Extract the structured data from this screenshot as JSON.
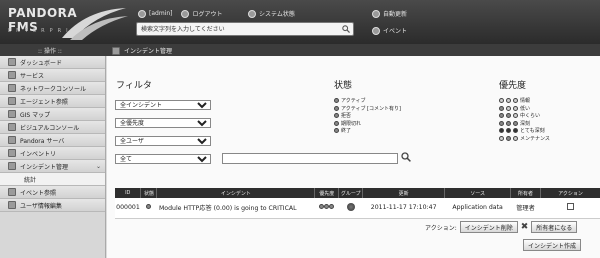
{
  "header": {
    "logo_main": "PANDORA",
    "logo_fms": "FMS",
    "logo_sub": "ENTERPRISE",
    "user": "[admin]",
    "user_action": "ログアウト",
    "system_status": "システム状態",
    "auto_refresh": "自動更新",
    "events": "イベント",
    "search_placeholder": "検索文字列を入力してください"
  },
  "subbar": {
    "operation_label": "操作",
    "page_title": "インシデント管理"
  },
  "sidebar": {
    "items": [
      {
        "label": "ダッシュボード"
      },
      {
        "label": "サービス"
      },
      {
        "label": "ネットワークコンソール"
      },
      {
        "label": "エージェント参照"
      },
      {
        "label": "GIS マップ"
      },
      {
        "label": "ビジュアルコンソール"
      },
      {
        "label": "Pandora サーバ"
      },
      {
        "label": "インベントリ"
      },
      {
        "label": "インシデント管理"
      },
      {
        "label": "統計"
      },
      {
        "label": "イベント参照"
      },
      {
        "label": "ユーザ情報編集"
      }
    ]
  },
  "filter": {
    "title": "フィルタ",
    "incidents_value": "全インシデント",
    "priority_value": "全優先度",
    "users_value": "全ユーザ",
    "groups_value": "全て"
  },
  "status_legend": {
    "title": "状態",
    "items": [
      "アクティブ",
      "アクティブ [コメント有り]",
      "拒否",
      "期限切れ",
      "終了"
    ]
  },
  "priority_legend": {
    "title": "優先度",
    "items": [
      "情報",
      "低い",
      "中くらい",
      "深刻",
      "とても深刻",
      "メンテナンス"
    ]
  },
  "table": {
    "headers": [
      "ID",
      "状態",
      "インシデント",
      "優先度",
      "グループ",
      "更新",
      "ソース",
      "所有者",
      "アクション"
    ],
    "rows": [
      {
        "id": "000001",
        "incident": "Module HTTP応答 (0.00) is going to CRITICAL",
        "updated": "2011-11-17 17:10:47",
        "source": "Application data",
        "owner": "管理者"
      }
    ]
  },
  "actions": {
    "label": "アクション:",
    "delete_button": "インシデント削除",
    "become_owner_button": "所有者になる",
    "create_button": "インシデント作成"
  }
}
